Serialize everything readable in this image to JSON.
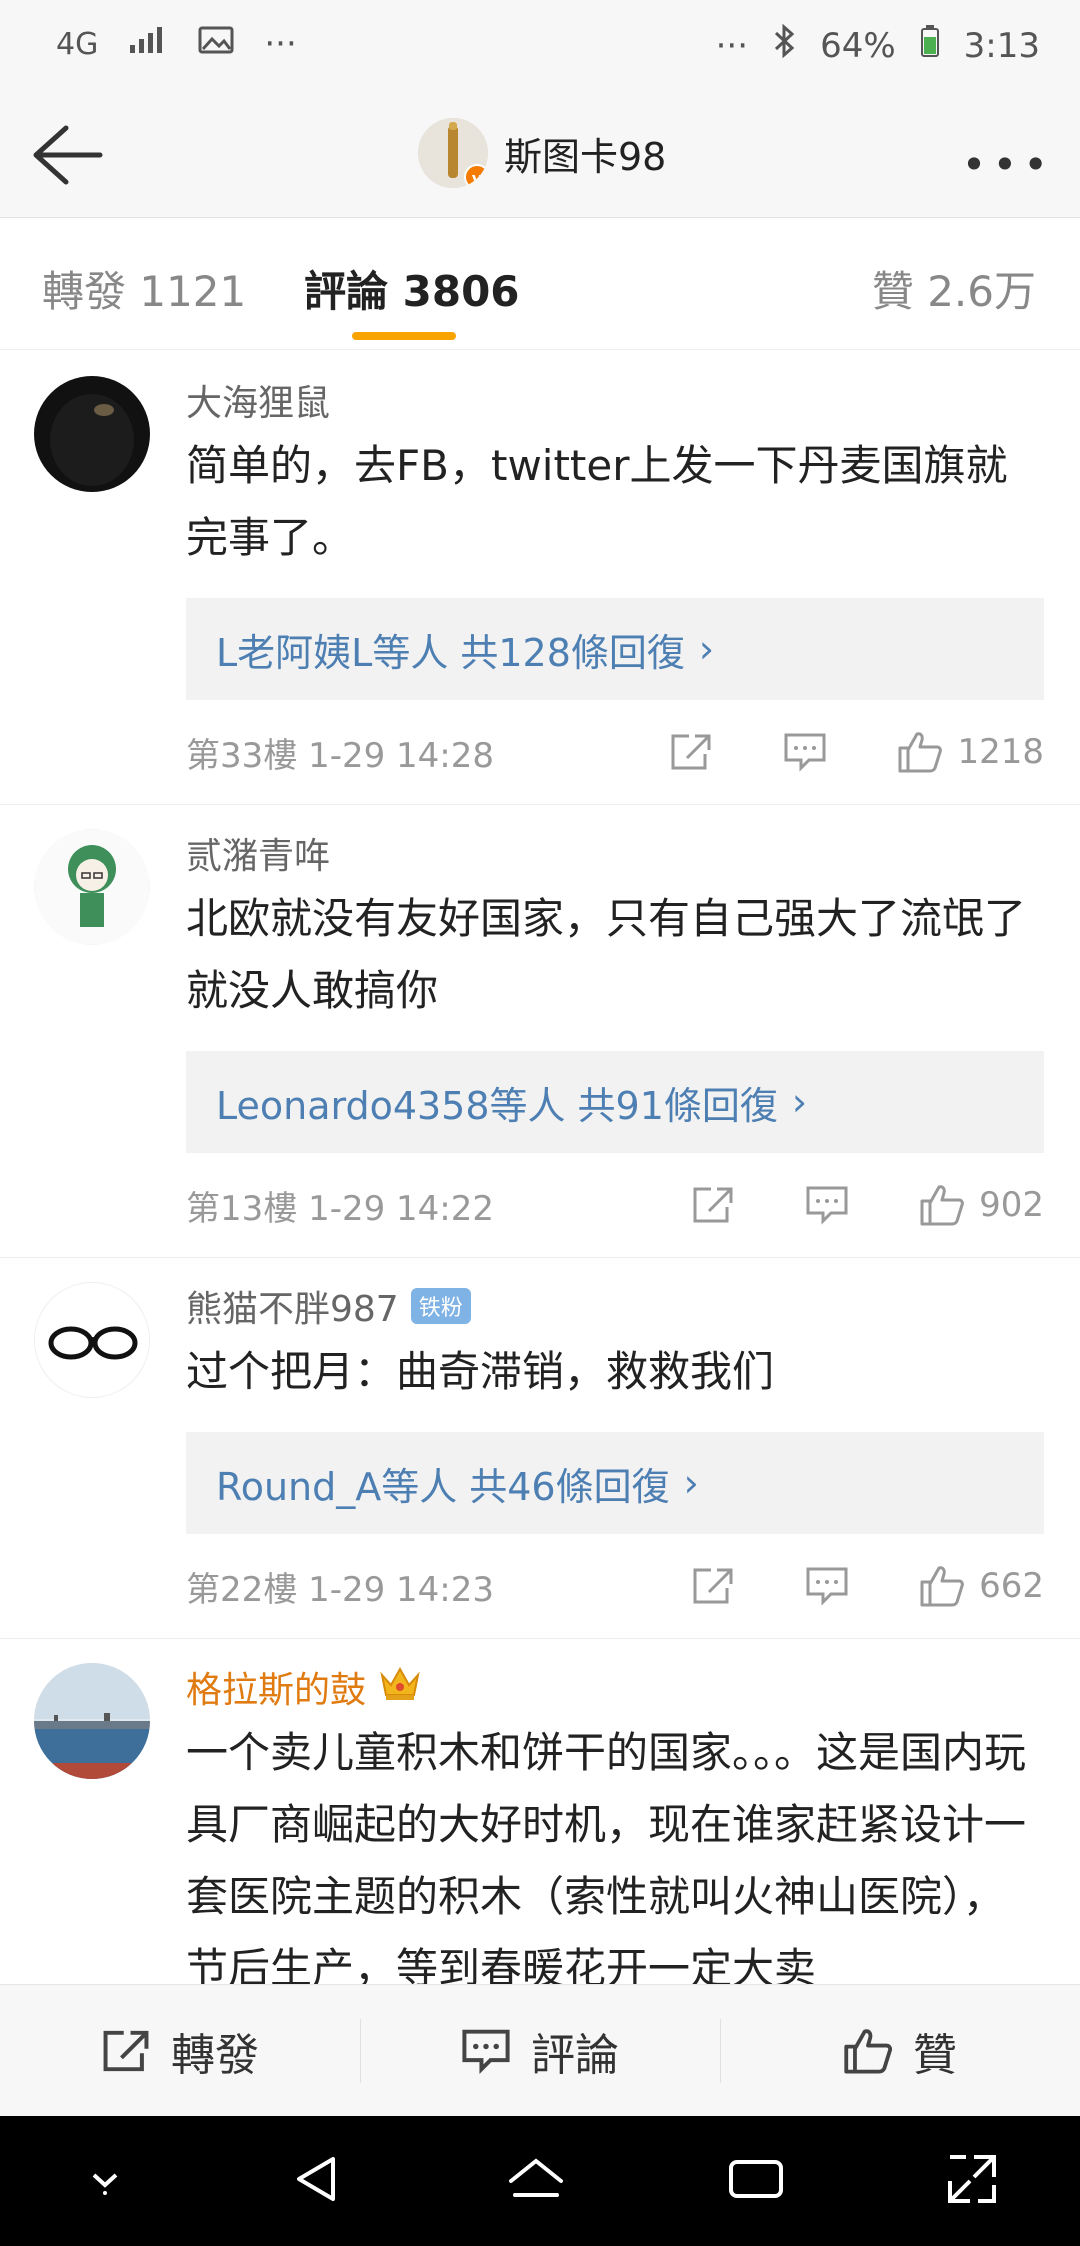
{
  "status_bar": {
    "network": "4G",
    "battery": "64%",
    "time": "3:13"
  },
  "nav": {
    "title": "斯图卡98"
  },
  "tabs": {
    "repost": "轉發 1121",
    "comments": "評論 3806",
    "likes": "贊 2.6万"
  },
  "comments": [
    {
      "user": "大海狸鼠",
      "text": "简单的，去FB，twitter上发一下丹麦国旗就完事了。",
      "reply_users": "L老阿姨L等人",
      "reply_count": "共128條回復",
      "floor_time": "第33樓 1-29 14:28",
      "likes": "1218"
    },
    {
      "user": "贰潴青哖",
      "text": "北欧就没有友好国家，只有自己强大了流氓了就没人敢搞你",
      "reply_users": "Leonardo4358等人",
      "reply_count": "共91條回復",
      "floor_time": "第13樓 1-29 14:22",
      "likes": "902"
    },
    {
      "user": "熊猫不胖987",
      "badge": "铁粉",
      "text": "过个把月：曲奇滞销，救救我们",
      "reply_users": "Round_A等人",
      "reply_count": "共46條回復",
      "floor_time": "第22樓 1-29 14:23",
      "likes": "662"
    },
    {
      "user": "格拉斯的鼓",
      "text": "一个卖儿童积木和饼干的国家。。。这是国内玩具厂商崛起的大好时机，现在谁家赶紧设计一套医院主题的积木（索性就叫火神山医院），节后生产，等到春暖花开一定大卖"
    }
  ],
  "bottom_bar": {
    "repost": "轉發",
    "comment": "評論",
    "like": "贊"
  },
  "colors": {
    "accent": "#f8a300",
    "link": "#4d7fb3",
    "vip_name": "#e07b12"
  }
}
